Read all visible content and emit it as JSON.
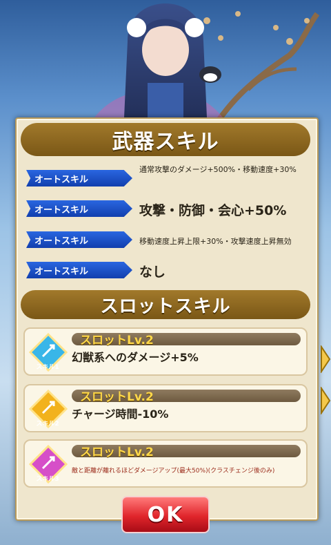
{
  "weapon_skill": {
    "title": "武器スキル",
    "auto_skills": [
      {
        "tag": "オートスキル",
        "description": "通常攻撃のダメージ+500%・移動速度+30%"
      },
      {
        "tag": "オートスキル",
        "description": "攻撃・防御・会心+50%"
      },
      {
        "tag": "オートスキル",
        "description": "移動速度上昇上限+30%・攻撃速度上昇無効"
      },
      {
        "tag": "オートスキル",
        "description": "なし"
      }
    ]
  },
  "slot_skill": {
    "title": "スロットスキル",
    "slots": [
      {
        "level": "スロットLv.2",
        "badge": "スキル1",
        "description": "幻獣系へのダメージ+5%",
        "color": "#39b6e8"
      },
      {
        "level": "スロットLv.2",
        "badge": "スキル2",
        "description": "チャージ時間-10%",
        "color": "#f2b21c"
      },
      {
        "level": "スロットLv.2",
        "badge": "スキル3",
        "description": "敵と距離が離れるほどダメージアップ(最大50%)(クラスチェンジ後のみ)",
        "color": "#d64fc8"
      }
    ]
  },
  "ok_button": {
    "label": "OK"
  }
}
